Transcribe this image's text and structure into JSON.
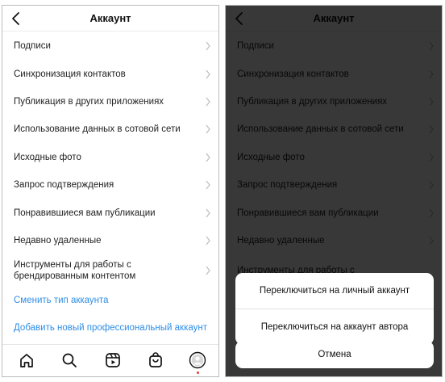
{
  "header": {
    "title": "Аккаунт"
  },
  "menu": {
    "items": [
      {
        "label": "Подписи"
      },
      {
        "label": "Синхронизация контактов"
      },
      {
        "label": "Публикация в других приложениях"
      },
      {
        "label": "Использование данных в сотовой сети"
      },
      {
        "label": "Исходные фото"
      },
      {
        "label": "Запрос подтверждения"
      },
      {
        "label": "Понравившиеся вам публикации"
      },
      {
        "label": "Недавно удаленные"
      },
      {
        "label_line1": "Инструменты для работы с",
        "label_line2": "брендированным контентом"
      }
    ],
    "links": [
      {
        "label": "Сменить тип аккаунта"
      },
      {
        "label": "Добавить новый профессиональный аккаунт"
      }
    ]
  },
  "tabbar": {
    "icons": [
      "home-icon",
      "search-icon",
      "reels-icon",
      "shop-icon",
      "profile-icon"
    ]
  },
  "sheet": {
    "option_personal": "Переключиться на личный аккаунт",
    "option_creator": "Переключиться на аккаунт автора",
    "cancel": "Отмена"
  },
  "colors": {
    "link": "#2f8ee6",
    "notification_dot": "#e53935",
    "overlay": "#000000"
  }
}
